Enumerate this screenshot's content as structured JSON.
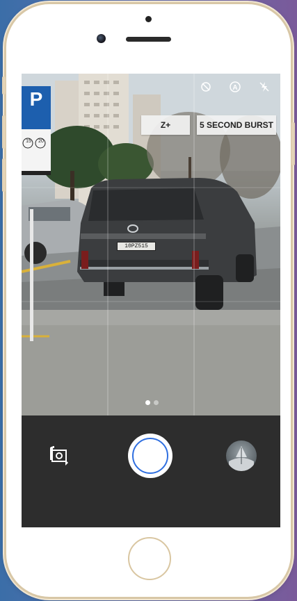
{
  "camera": {
    "zoom_label": "Z+",
    "burst_label": "5 SECOND BURST",
    "flash_mode": "A"
  },
  "scene": {
    "plate_text": "10PZ515",
    "parking_sign_letter": "P",
    "sign_badges": [
      "15",
      "20"
    ]
  },
  "pager": {
    "count": 2,
    "active_index": 0
  },
  "colors": {
    "shutter_ring": "#2f6fe0",
    "bottom_bar": "#2d2d2d",
    "parking_sign_blue": "#1d5fae"
  }
}
